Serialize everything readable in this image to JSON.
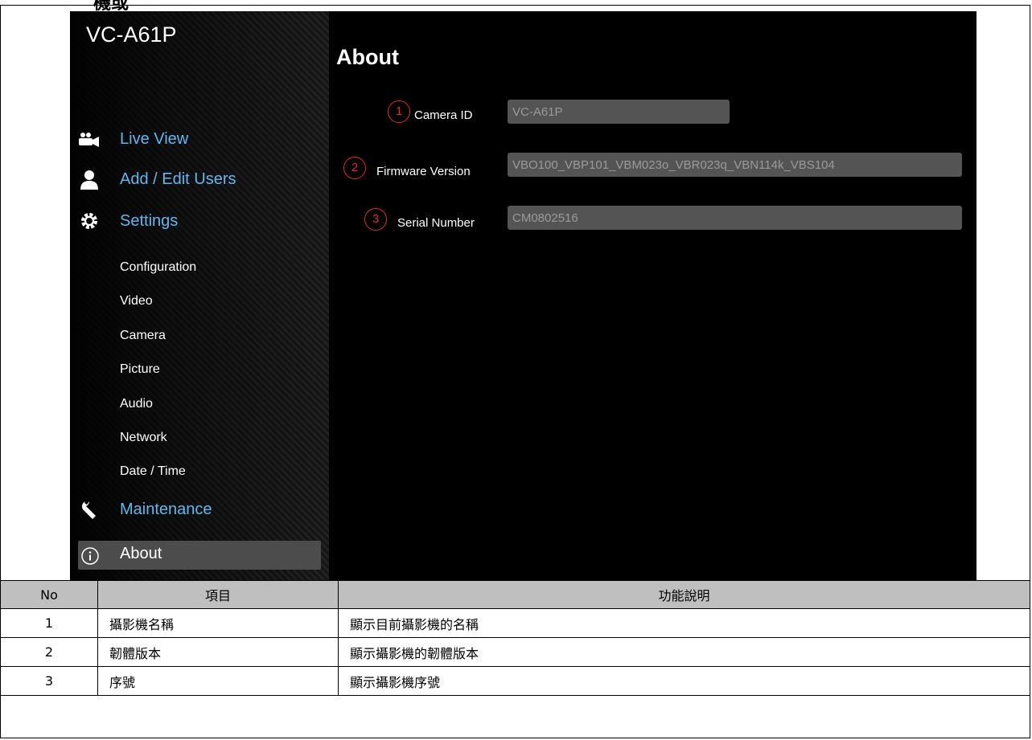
{
  "doc": {
    "heading_fragment": "機或"
  },
  "app": {
    "model_name": "VC-A61P",
    "page_title": "About"
  },
  "sidebar": {
    "main_items": [
      {
        "label": "Live View",
        "icon": "camera-users-icon"
      },
      {
        "label": "Add / Edit Users",
        "icon": "user-icon"
      },
      {
        "label": "Settings",
        "icon": "gear-icon"
      }
    ],
    "settings_sub": [
      "Configuration",
      "Video",
      "Camera",
      "Picture",
      "Audio",
      "Network",
      "Date / Time"
    ],
    "maintenance": {
      "label": "Maintenance",
      "icon": "wrench-icon"
    },
    "about": {
      "label": "About",
      "icon": "info-icon"
    }
  },
  "fields": [
    {
      "callout": "1",
      "label": "Camera ID",
      "value": "VC-A61P"
    },
    {
      "callout": "2",
      "label": "Firmware Version",
      "value": "VBO100_VBP101_VBM023o_VBR023q_VBN114k_VBS104"
    },
    {
      "callout": "3",
      "label": "Serial Number",
      "value": "CM0802516"
    }
  ],
  "table": {
    "headers": [
      "No",
      "項目",
      "功能說明"
    ],
    "rows": [
      [
        "1",
        "攝影機名稱",
        "顯示目前攝影機的名稱"
      ],
      [
        "2",
        "韌體版本",
        "顯示攝影機的韌體版本"
      ],
      [
        "3",
        "序號",
        "顯示攝影機序號"
      ]
    ]
  },
  "colors": {
    "nav_accent": "#5fb8f0",
    "callout_red": "#e8232a",
    "field_bg": "#545454",
    "active_bg": "#4c4c4c"
  }
}
